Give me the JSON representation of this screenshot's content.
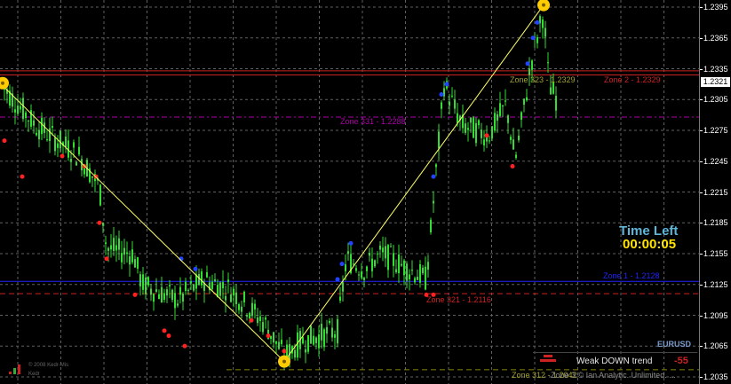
{
  "chart": {
    "symbol": "EURUSD",
    "current_price": "1.2321",
    "price_axis": {
      "ticks": [
        "1.2395",
        "1.2365",
        "1.2335",
        "1.2305",
        "1.2275",
        "1.2245",
        "1.2215",
        "1.2185",
        "1.2155",
        "1.2125",
        "1.2095",
        "1.2065",
        "1.2035"
      ]
    },
    "zones": {
      "zone2_label": "Zone 2 - 1.2329",
      "zone323_label": "Zone 323 - 1.2329",
      "zone331_label": "Zone 331 - 1.2288",
      "zone1_label": "Zone 1 - 1.2128",
      "zone321_label": "Zone 321 - 1.2116",
      "zone312_label": "Zone 312 - 1.2042"
    },
    "time_left": {
      "title": "Time Left",
      "value": "00:00:05"
    },
    "trend": {
      "label": "Weak DOWN trend",
      "value": "-55"
    },
    "footer": {
      "copyright_line1": "© 2008 Kedr-Mis",
      "copyright_line2": "Kedr",
      "info": "Zone 3 © Ian Analytic. Unlimited. ..."
    },
    "colors": {
      "candles": "#33dd33",
      "grid": "#606060",
      "zigzag": "#ffff66",
      "zone2": "#cc2222",
      "zone331": "#aa00aa",
      "zone1": "#2222ff",
      "zone321": "#cc2222",
      "zone312": "#888800",
      "swing_marker": "#ffcc00",
      "high_dot": "#2244ff",
      "low_dot": "#ff2222"
    }
  },
  "chart_data": {
    "type": "candlestick",
    "y_label_values": [
      1.2395,
      1.2365,
      1.2335,
      1.2305,
      1.2275,
      1.2245,
      1.2215,
      1.2185,
      1.2155,
      1.2125,
      1.2095,
      1.2065,
      1.2035
    ],
    "ylim": [
      1.2032,
      1.2402
    ],
    "zigzag_points": [
      [
        0,
        1.2321
      ],
      [
        320,
        1.205
      ],
      [
        612,
        1.2397
      ]
    ],
    "horizontal_levels": [
      {
        "name": "Zone 2",
        "value": 1.2329
      },
      {
        "name": "Zone 331",
        "value": 1.2288
      },
      {
        "name": "Zone 1",
        "value": 1.2128
      },
      {
        "name": "Zone 321",
        "value": 1.2116
      },
      {
        "name": "Zone 312",
        "value": 1.2042
      }
    ],
    "grid": true
  }
}
